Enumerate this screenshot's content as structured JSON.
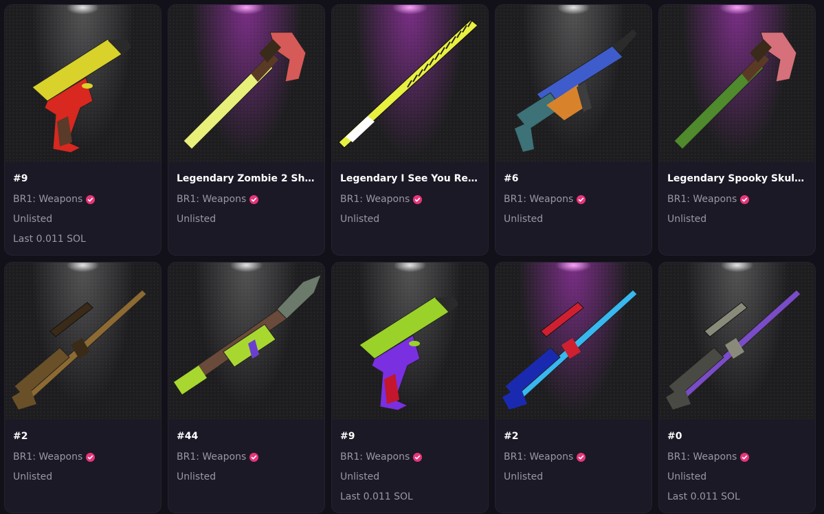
{
  "items": [
    {
      "title": "#9",
      "collection": "BR1: Weapons",
      "status": "Unlisted",
      "last": "Last 0.011 SOL",
      "weapon": "pistol-icon",
      "light": "white",
      "colors": {
        "primary": "#d8d22a",
        "secondary": "#d8281f",
        "accent": "#5a3a28"
      }
    },
    {
      "title": "Legendary Zombie 2 Sho...",
      "collection": "BR1: Weapons",
      "status": "Unlisted",
      "last": "",
      "weapon": "axe-icon",
      "light": "purple",
      "colors": {
        "primary": "#e8f07a",
        "secondary": "#d65a58",
        "accent": "#5a3a25"
      }
    },
    {
      "title": "Legendary I See You Rea...",
      "collection": "BR1: Weapons",
      "status": "Unlisted",
      "last": "",
      "weapon": "bat-icon",
      "light": "purple",
      "colors": {
        "primary": "#e8f040",
        "secondary": "#22221c",
        "accent": "#ffffff"
      }
    },
    {
      "title": "#6",
      "collection": "BR1: Weapons",
      "status": "Unlisted",
      "last": "",
      "weapon": "rifle-icon",
      "light": "white",
      "colors": {
        "primary": "#3f5ccc",
        "secondary": "#d9822c",
        "accent": "#3c7278"
      }
    },
    {
      "title": "Legendary Spooky Skull...",
      "collection": "BR1: Weapons",
      "status": "Unlisted",
      "last": "",
      "weapon": "axe-icon",
      "light": "purple",
      "colors": {
        "primary": "#4f8a2c",
        "secondary": "#d6707a",
        "accent": "#5a3a25"
      }
    },
    {
      "title": "#2",
      "collection": "BR1: Weapons",
      "status": "Unlisted",
      "last": "",
      "weapon": "sniper-icon",
      "light": "white",
      "colors": {
        "primary": "#8c6a32",
        "secondary": "#6a5028",
        "accent": "#3a2a18"
      }
    },
    {
      "title": "#44",
      "collection": "BR1: Weapons",
      "status": "Unlisted",
      "last": "",
      "weapon": "rpg-icon",
      "light": "white",
      "colors": {
        "primary": "#a8d830",
        "secondary": "#6a4a3a",
        "accent": "#6b7a6a"
      }
    },
    {
      "title": "#9",
      "collection": "BR1: Weapons",
      "status": "Unlisted",
      "last": "Last 0.011 SOL",
      "weapon": "pistol-icon",
      "light": "white",
      "colors": {
        "primary": "#9ad22a",
        "secondary": "#7a2fe0",
        "accent": "#c4162c"
      }
    },
    {
      "title": "#2",
      "collection": "BR1: Weapons",
      "status": "Unlisted",
      "last": "",
      "weapon": "sniper-icon",
      "light": "purple",
      "colors": {
        "primary": "#38b8f0",
        "secondary": "#1a2ab0",
        "accent": "#d02030"
      }
    },
    {
      "title": "#0",
      "collection": "BR1: Weapons",
      "status": "Unlisted",
      "last": "Last 0.011 SOL",
      "weapon": "sniper-icon",
      "light": "white",
      "colors": {
        "primary": "#7a4cc8",
        "secondary": "#4a4a44",
        "accent": "#8a8a7a"
      }
    }
  ],
  "badge": {
    "icon": "verified-check-icon",
    "color": "#e8357a"
  }
}
